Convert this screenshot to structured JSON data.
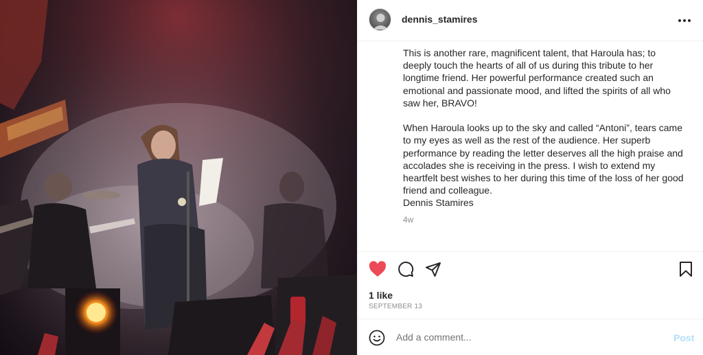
{
  "post": {
    "username": "dennis_stamires",
    "caption": "This is another rare, magnificent talent, that Haroula has; to deeply touch the hearts of all of us during this tribute to her longtime friend. Her powerful performance created such an emotional and passionate mood, and lifted the spirits of all who saw her, BRAVO!\n\nWhen Haroula looks up to the sky and called “Antoni”, tears came to my eyes as well as the rest of the audience. Her superb performance by reading the letter deserves all the high praise and accolades she is receiving in the press. I wish to extend my heartfelt best wishes to her during this time of the loss of her good friend and colleague.\nDennis Stamires",
    "time_ago": "4w",
    "likes": "1 like",
    "date": "SEPTEMBER 13"
  },
  "comment": {
    "placeholder": "Add a comment...",
    "post_label": "Post"
  },
  "icons": {
    "like": "heart-icon",
    "comment": "comment-icon",
    "share": "share-icon",
    "save": "bookmark-icon",
    "more": "more-options-icon",
    "emoji": "emoji-icon"
  },
  "colors": {
    "like_active": "#ed4956",
    "post_button_disabled": "#b2dffc",
    "muted_text": "#8e8e8e"
  }
}
